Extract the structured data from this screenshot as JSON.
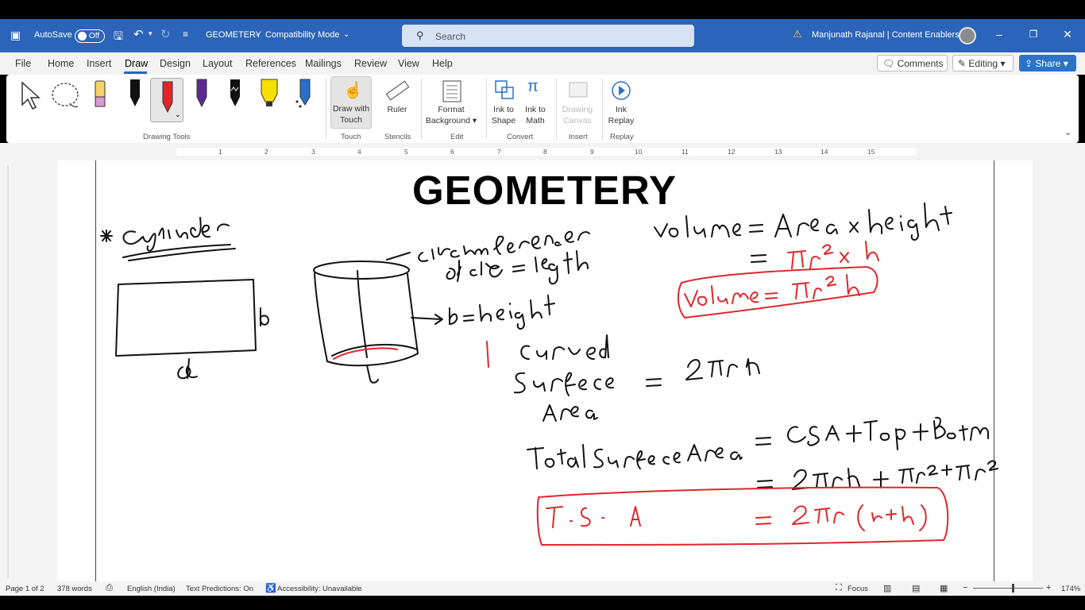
{
  "titlebar": {
    "autosave_label": "AutoSave",
    "autosave_state": "Off",
    "doc_title": "GEOMETERY",
    "sep": "-",
    "mode": "Compatibility Mode",
    "search_placeholder": "Search",
    "user": "Manjunath Rajanal | Content Enablers"
  },
  "menu": {
    "items": [
      "File",
      "Home",
      "Insert",
      "Draw",
      "Design",
      "Layout",
      "References",
      "Mailings",
      "Review",
      "View",
      "Help"
    ],
    "comments": "Comments",
    "editing": "Editing",
    "share": "Share"
  },
  "ribbon": {
    "draw_with_touch": [
      "Draw with",
      "Touch"
    ],
    "ruler": "Ruler",
    "format_background": [
      "Format",
      "Background"
    ],
    "ink_to_shape": [
      "Ink to",
      "Shape"
    ],
    "ink_to_math": [
      "Ink to",
      "Math"
    ],
    "drawing_canvas": [
      "Drawing",
      "Canvas"
    ],
    "ink_replay": [
      "Ink",
      "Replay"
    ],
    "groups": {
      "drawing_tools": "Drawing Tools",
      "touch": "Touch",
      "stencils": "Stencils",
      "edit": "Edit",
      "convert": "Convert",
      "insert": "Insert",
      "replay": "Replay"
    },
    "pen_colors": [
      "#f5d36a",
      "#111111",
      "#e0262b",
      "#5b2c8f",
      "#111111",
      "#f6e000",
      "#2a6fc9"
    ]
  },
  "ruler": {
    "numbers": [
      "1",
      "2",
      "3",
      "4",
      "5",
      "6",
      "7",
      "8",
      "9",
      "10",
      "11",
      "12",
      "13",
      "14",
      "15"
    ]
  },
  "document": {
    "title": "GEOMETERY"
  },
  "status": {
    "page": "Page 1 of 2",
    "words": "378 words",
    "language": "English (India)",
    "text_predictions": "Text Predictions: On",
    "accessibility": "Accessibility: Unavailable",
    "focus": "Focus",
    "zoom": "174%"
  }
}
